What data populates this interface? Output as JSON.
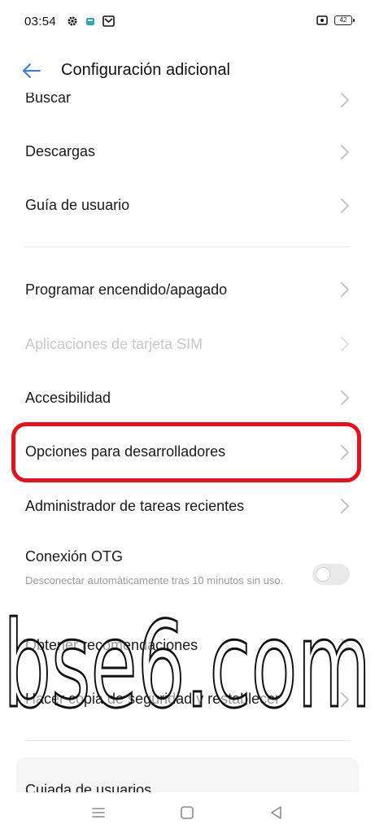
{
  "status_bar": {
    "time": "03:54",
    "battery": "42"
  },
  "header": {
    "title": "Configuración adicional"
  },
  "items": [
    {
      "label": "Buscar"
    },
    {
      "label": "Descargas"
    },
    {
      "label": "Guía de usuario"
    },
    {
      "label": "Programar encendido/apagado"
    },
    {
      "label": "Aplicaciones de tarjeta SIM",
      "disabled": true
    },
    {
      "label": "Accesibilidad"
    },
    {
      "label": "Opciones para desarrolladores",
      "highlighted": true
    },
    {
      "label": "Administrador de tareas recientes"
    },
    {
      "label": "Conexión OTG",
      "subtext": "Desconectar automáticamente tras 10 minutos sin uso.",
      "toggle": false
    },
    {
      "label": "Obtener recomendaciones"
    },
    {
      "label": "Hacer copia de seguridad y restablecer"
    },
    {
      "label": "Cuiada de usuarios"
    }
  ],
  "watermark": "bse6.com",
  "colors": {
    "highlight": "#e3121b",
    "accent": "#3a7bd5"
  }
}
